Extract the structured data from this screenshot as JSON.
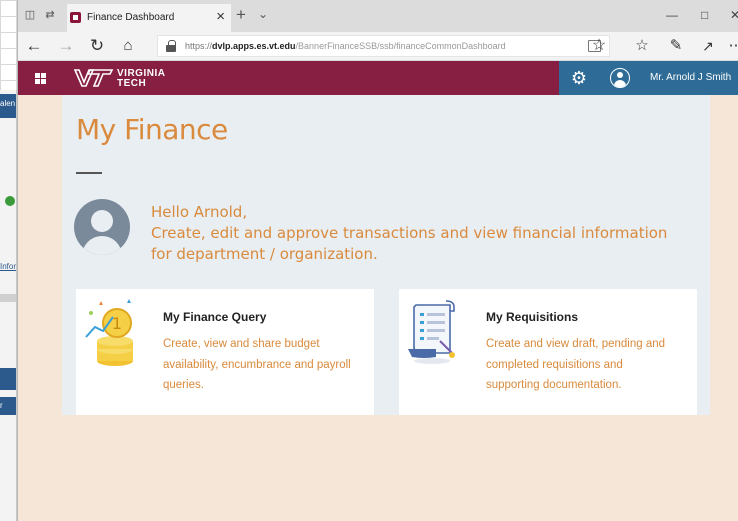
{
  "browser": {
    "tab_title": "Finance Dashboard",
    "url_protocol": "https://",
    "url_domain": "dvlp.apps.es.vt.edu",
    "url_path": "/BannerFinanceSSB/ssb/financeCommonDashboard"
  },
  "bg_window": {
    "texts": [
      "alen",
      "Infor",
      "r"
    ]
  },
  "app": {
    "brand_line1": "VIRGINIA",
    "brand_line2": "TECH",
    "user_name": "Mr. Arnold J Smith",
    "colors": {
      "maroon": "#861f41",
      "blue": "#2e6b96",
      "orange": "#d98a3c"
    }
  },
  "main": {
    "title": "My Finance",
    "greeting_line1": "Hello Arnold,",
    "greeting_line2": "Create, edit and approve transactions and view financial information for department / organization.",
    "cards": [
      {
        "title": "My Finance Query",
        "description": "Create, view and share budget availability, encumbrance and payroll queries."
      },
      {
        "title": "My Requisitions",
        "description": "Create and view draft, pending and completed requisitions and supporting documentation."
      }
    ]
  }
}
